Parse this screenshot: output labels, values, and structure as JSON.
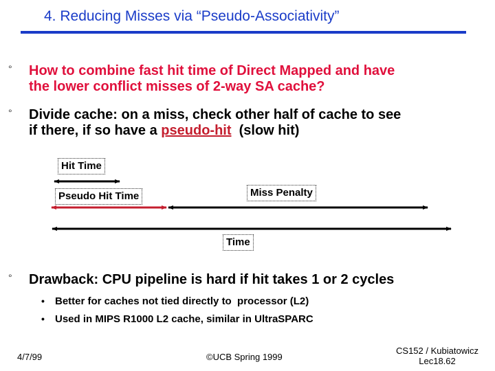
{
  "slide": {
    "title": "4. Reducing Misses via “Pseudo-Associativity”",
    "bullets": [
      {
        "marker": "°",
        "lines": [
          "How to combine fast hit time of Direct Mapped and have",
          "the lower conflict misses of 2-way SA cache?"
        ],
        "color": "#e0103c"
      },
      {
        "marker": "°",
        "line1": "Divide cache: on a miss, check other half of cache to see",
        "line2_prefix": "if there, if so have a ",
        "line2_link": "pseudo-hit",
        "line2_suffix": "  (slow hit)"
      },
      {
        "marker": "°",
        "text": "Drawback: CPU pipeline is hard if hit takes 1 or 2 cycles",
        "subitems": [
          {
            "marker": "•",
            "text": "Better for caches not tied directly to  processor (L2)"
          },
          {
            "marker": "•",
            "text": "Used in MIPS R1000 L2 cache, similar in UltraSPARC"
          }
        ]
      }
    ]
  },
  "diagram": {
    "labels": {
      "hit_time": "Hit Time",
      "pseudo_hit_time": "Pseudo Hit Time",
      "miss_penalty": "Miss Penalty",
      "time": "Time"
    },
    "colors": {
      "pseudo_hit_arrow": "#c41e2e",
      "arrow": "#000000"
    }
  },
  "footer": {
    "date": "4/7/99",
    "copyright": "©UCB Spring 1999",
    "course": "CS152 / Kubiatowicz",
    "lecture": "Lec18.62"
  },
  "colors": {
    "title": "#1a3cc8",
    "emphasis": "#e0103c"
  }
}
